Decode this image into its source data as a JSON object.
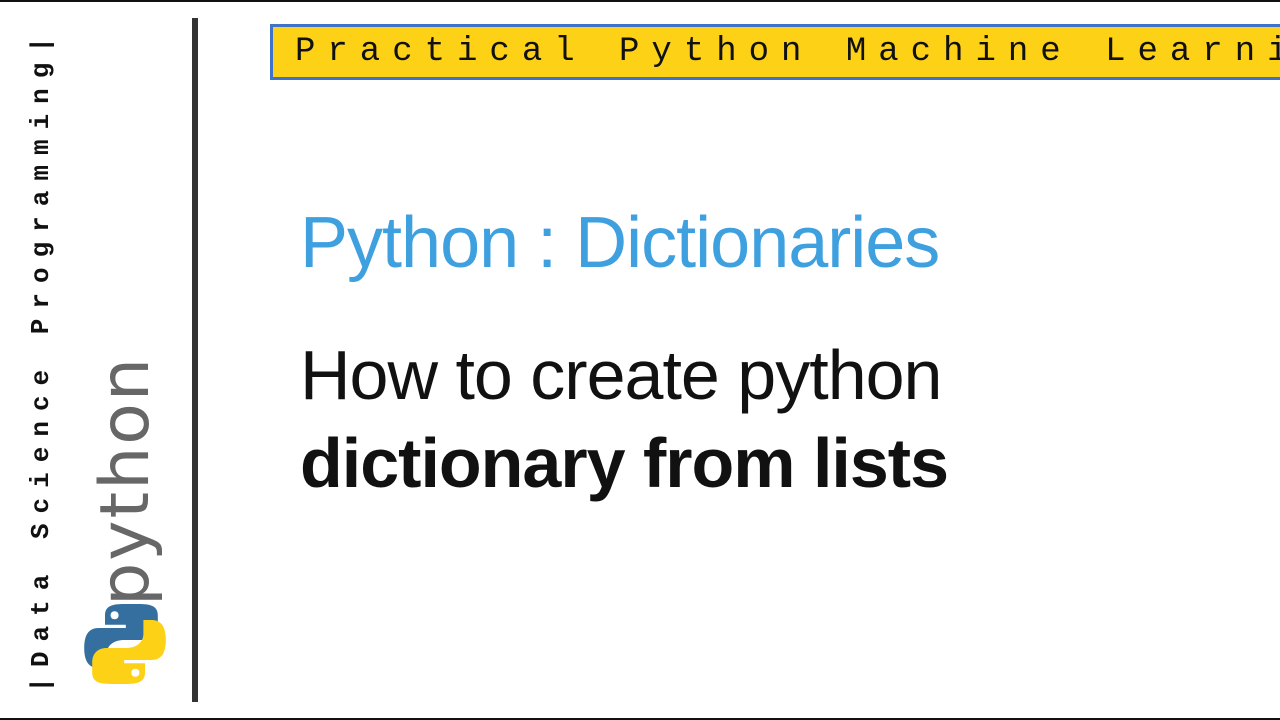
{
  "sidebar": {
    "vertical_text": "|Data Science Programming|",
    "python_word": "python"
  },
  "banner": {
    "text": "Practical Python Machine Learning"
  },
  "content": {
    "line1": "Python : Dictionaries",
    "line2a": "How to create python",
    "line2b": "dictionary from lists"
  },
  "colors": {
    "banner_bg": "#fcd116",
    "banner_border": "#3f73c9",
    "title_blue": "#3fa0e0"
  }
}
